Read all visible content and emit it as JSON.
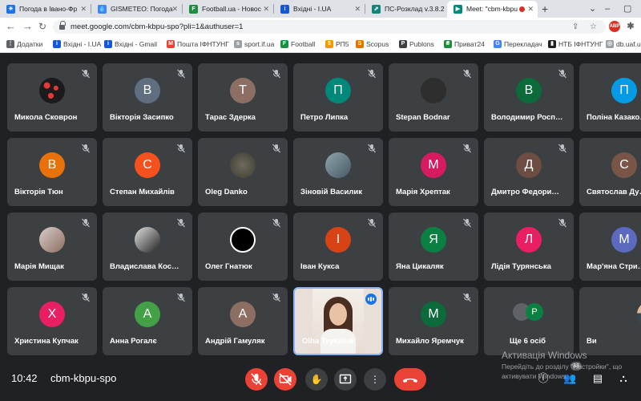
{
  "browser": {
    "tabs": [
      {
        "title": "Погода в Івано-Фр",
        "fav_color": "#1a73e8",
        "fav_glyph": "☀"
      },
      {
        "title": "GISMETEO: Погода",
        "fav_color": "#4285f4",
        "fav_glyph": "💧"
      },
      {
        "title": "Football.ua - Новос",
        "fav_color": "#1e8e3e",
        "fav_glyph": "F"
      },
      {
        "title": "Вхідні - I.UA",
        "fav_color": "#1558d6",
        "fav_glyph": "i"
      },
      {
        "title": "ПС-Розклад v.3.8.2",
        "fav_color": "#12857a",
        "fav_glyph": "⇗"
      },
      {
        "title": "Meet: \"cbm-kbpu",
        "fav_color": "#00897b",
        "fav_glyph": "▶"
      }
    ],
    "url": "meet.google.com/cbm-kbpu-spo?pli=1&authuser=1",
    "bookmarks": [
      {
        "label": "Додатки",
        "color": "#5f6368",
        "glyph": "⋮"
      },
      {
        "label": "Вхідні - I.UA",
        "color": "#1558d6",
        "glyph": "i"
      },
      {
        "label": "Вхідні - Gmail",
        "color": "#1558d6",
        "glyph": "i"
      },
      {
        "label": "Пошта ІФНТУНГ",
        "color": "#ea4335",
        "glyph": "M"
      },
      {
        "label": "sport.if.ua",
        "color": "#9aa0a6",
        "glyph": "s"
      },
      {
        "label": "Football",
        "color": "#1e8e3e",
        "glyph": "F"
      },
      {
        "label": "РП5",
        "color": "#f29900",
        "glyph": "5"
      },
      {
        "label": "Scopus",
        "color": "#e37400",
        "glyph": "S"
      },
      {
        "label": "Publons",
        "color": "#3c4043",
        "glyph": "P"
      },
      {
        "label": "Приват24",
        "color": "#1e8e3e",
        "glyph": "₴"
      },
      {
        "label": "Перекладач",
        "color": "#4285f4",
        "glyph": "G"
      },
      {
        "label": "НТБ ІФНТУНГ",
        "color": "#202124",
        "glyph": "▮"
      },
      {
        "label": "db.uaf.ua",
        "color": "#9aa0a6",
        "glyph": "◎"
      }
    ]
  },
  "participants": [
    {
      "name": "Микола Сковрон",
      "initial": "",
      "color": "#2b2b2b",
      "photo": "red-dots"
    },
    {
      "name": "Вікторія Засипко",
      "initial": "В",
      "color": "#5f6f80"
    },
    {
      "name": "Тарас Здерка",
      "initial": "Т",
      "color": "#8d6e63"
    },
    {
      "name": "Петро Липка",
      "initial": "П",
      "color": "#00897b"
    },
    {
      "name": "Stepan Bodnar",
      "initial": "",
      "color": "#2e2e2e",
      "photo": "dark"
    },
    {
      "name": "Володимир Росп…",
      "initial": "В",
      "color": "#0b6b3a"
    },
    {
      "name": "Поліна Казако…",
      "initial": "П",
      "color": "#039be5"
    },
    {
      "name": "Вікторія Тюн",
      "initial": "В",
      "color": "#e8710a"
    },
    {
      "name": "Степан Михайлів",
      "initial": "С",
      "color": "#f4511e"
    },
    {
      "name": "Oleg Danko",
      "initial": "",
      "color": "#4a4a40",
      "photo": "grey"
    },
    {
      "name": "Зіновій Василик",
      "initial": "",
      "color": "#6a7380",
      "photo": "people"
    },
    {
      "name": "Марія Хрептак",
      "initial": "М",
      "color": "#d81b60"
    },
    {
      "name": "Дмитро Федори…",
      "initial": "Д",
      "color": "#6d4c41"
    },
    {
      "name": "Святослав Ду…",
      "initial": "С",
      "color": "#795548"
    },
    {
      "name": "Марія Мищак",
      "initial": "",
      "color": "#8a7060",
      "photo": "portrait"
    },
    {
      "name": "Владислава Кос…",
      "initial": "",
      "color": "#333333",
      "photo": "bw"
    },
    {
      "name": "Олег Гнатюк",
      "initial": "",
      "color": "#111111",
      "photo": "logo"
    },
    {
      "name": "Іван Кукса",
      "initial": "І",
      "color": "#d84315"
    },
    {
      "name": "Яна Цикаляк",
      "initial": "Я",
      "color": "#0b8043"
    },
    {
      "name": "Лідія Турянська",
      "initial": "Л",
      "color": "#e91e63"
    },
    {
      "name": "Мар'яна Стри…",
      "initial": "М",
      "color": "#5c6bc0"
    },
    {
      "name": "Христина Купчак",
      "initial": "Х",
      "color": "#e91e63"
    },
    {
      "name": "Анна Рогалє",
      "initial": "А",
      "color": "#43a047"
    },
    {
      "name": "Андрій Гамуляк",
      "initial": "А",
      "color": "#8d6e63"
    },
    {
      "name": "Olha Tsykaliak",
      "initial": "",
      "color": "",
      "speaking": true
    },
    {
      "name": "Михайло Яремчук",
      "initial": "М",
      "color": "#0b6b3a"
    },
    {
      "name": "Ще 6 осіб",
      "initial": "P",
      "color": "#0b8043",
      "more": true
    },
    {
      "name": "Ви",
      "initial": "",
      "color": "#dfe3e8",
      "photo": "you"
    }
  ],
  "meeting": {
    "time": "10:42",
    "code": "cbm-kbpu-spo",
    "participant_count": "33"
  },
  "watermark": {
    "title": "Активація Windows",
    "line1": "Перейдіть до розділу \"Настройки\", що",
    "line2": "активувати Windows."
  }
}
